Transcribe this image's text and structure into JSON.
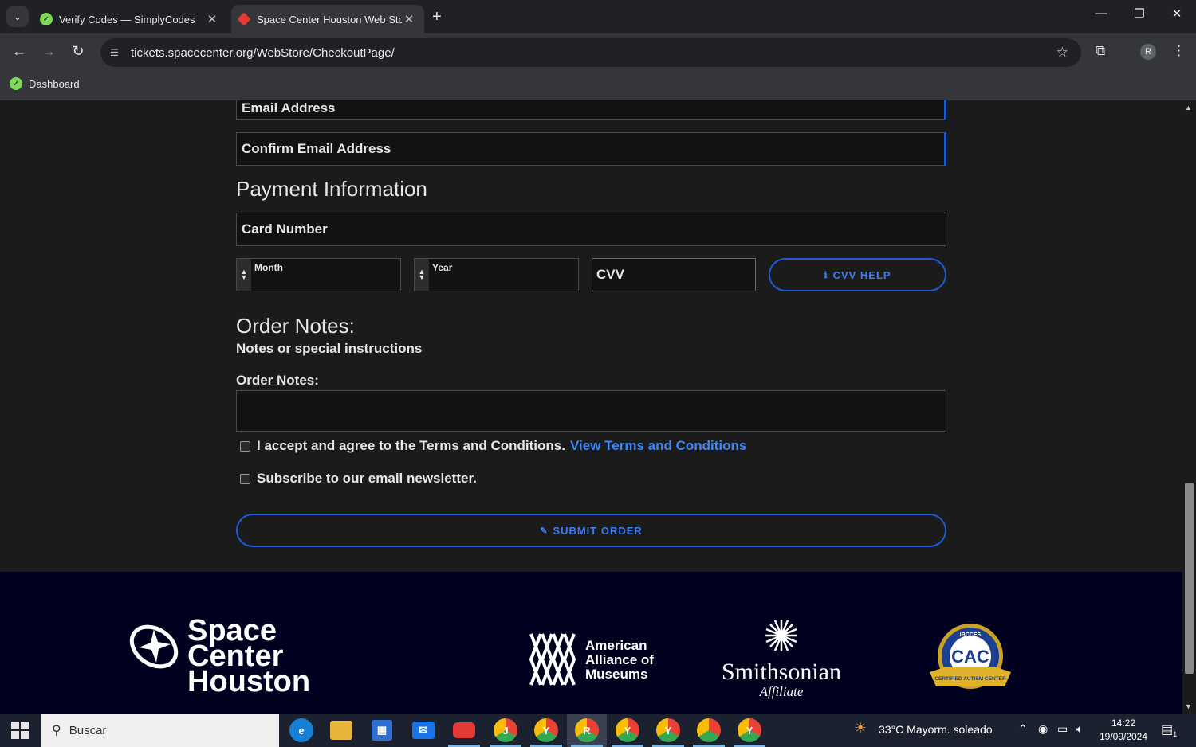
{
  "browser": {
    "tabs": [
      {
        "title": "Verify Codes — SimplyCodes",
        "active": false
      },
      {
        "title": "Space Center Houston Web Sto",
        "active": true
      }
    ],
    "url": "tickets.spacecenter.org/WebStore/CheckoutPage/",
    "bookmark": "Dashboard",
    "profile_initial": "R"
  },
  "form": {
    "email_placeholder": "Email Address",
    "confirm_email_placeholder": "Confirm Email Address",
    "payment_heading": "Payment Information",
    "card_number_placeholder": "Card Number",
    "month_label": "Month",
    "year_label": "Year",
    "cvv_placeholder": "CVV",
    "cvv_help": "CVV HELP",
    "order_notes_heading": "Order Notes:",
    "order_notes_sub": "Notes or special instructions",
    "order_notes_label": "Order Notes:",
    "terms_text": "I accept and agree to the Terms and Conditions.",
    "terms_link": "View Terms and Conditions",
    "newsletter_text": "Subscribe to our email newsletter.",
    "submit": "SUBMIT ORDER"
  },
  "footer": {
    "sch_line1": "Space",
    "sch_line2": "Center",
    "sch_line3": "Houston",
    "aam_line1": "American",
    "aam_line2": "Alliance of",
    "aam_line3": "Museums",
    "smithsonian": "Smithsonian",
    "smithsonian_sub": "Affiliate",
    "cac": "CAC",
    "cac_top": "IBCCES",
    "cac_ribbon": "CERTIFIED AUTISM CENTER"
  },
  "taskbar": {
    "search_placeholder": "Buscar",
    "weather": "33°C  Mayorm. soleado",
    "time": "14:22",
    "date": "19/09/2024",
    "notifications": "1"
  },
  "colors": {
    "accent": "#1e5bd6",
    "link": "#3d86f5",
    "footer_bg": "#00001f"
  }
}
